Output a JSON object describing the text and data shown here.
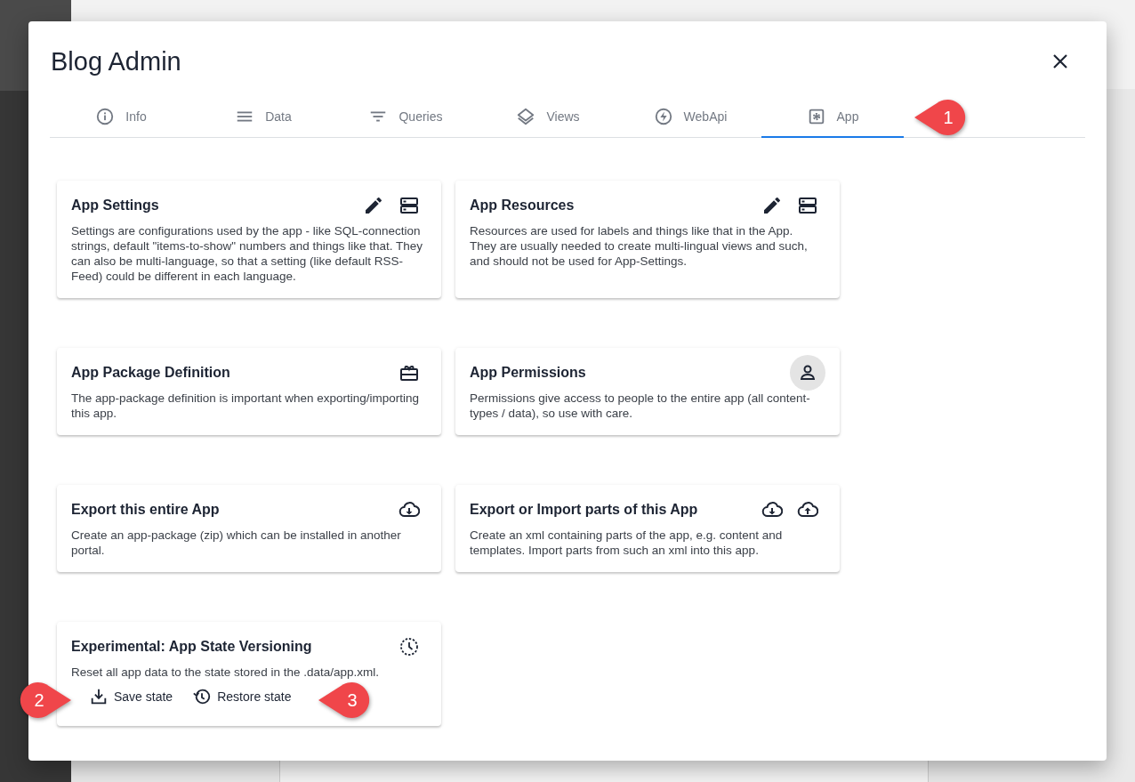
{
  "dialog": {
    "title": "Blog Admin"
  },
  "tabs": [
    {
      "label": "Info",
      "kind": "info",
      "selected": false
    },
    {
      "label": "Data",
      "kind": "data",
      "selected": false
    },
    {
      "label": "Queries",
      "kind": "queries",
      "selected": false
    },
    {
      "label": "Views",
      "kind": "views",
      "selected": false
    },
    {
      "label": "WebApi",
      "kind": "webapi",
      "selected": false
    },
    {
      "label": "App",
      "kind": "app",
      "selected": true
    }
  ],
  "cards": [
    {
      "title": "App Settings",
      "description": "Settings are configurations used by the app - like SQL-connection strings, default \"items-to-show\" numbers and things like that. They can also be multi-language, so that a setting (like default RSS-Feed) could be different in each language.",
      "icons": [
        {
          "kind": "edit",
          "hovered": false
        },
        {
          "kind": "storage",
          "hovered": false
        }
      ]
    },
    {
      "title": "App Resources",
      "description": "Resources are used for labels and things like that in the App. They are usually needed to create multi-lingual views and such, and should not be used for App-Settings.",
      "icons": [
        {
          "kind": "edit",
          "hovered": false
        },
        {
          "kind": "storage",
          "hovered": false
        }
      ]
    },
    {
      "title": "App Package Definition",
      "description": "The app-package definition is important when exporting/importing this app.",
      "icons": [
        {
          "kind": "package",
          "hovered": false
        }
      ]
    },
    {
      "title": "App Permissions",
      "description": "Permissions give access to people to the entire app (all content-types / data), so use with care.",
      "icons": [
        {
          "kind": "person",
          "hovered": true
        }
      ]
    },
    {
      "title": "Export this entire App",
      "description": "Create an app-package (zip) which can be installed in another portal.",
      "icons": [
        {
          "kind": "cloud-download",
          "hovered": false
        }
      ]
    },
    {
      "title": "Export or Import parts of this App",
      "description": "Create an xml containing parts of the app, e.g. content and templates. Import parts from such an xml into this app.",
      "icons": [
        {
          "kind": "cloud-download",
          "hovered": false
        },
        {
          "kind": "cloud-upload",
          "hovered": false
        }
      ]
    },
    {
      "title": "Experimental: App State Versioning",
      "description": "Reset all app data to the state stored in the .data/app.xml.",
      "icons": [
        {
          "kind": "history",
          "hovered": false
        }
      ],
      "actions": [
        {
          "label": "Save state",
          "kind": "download"
        },
        {
          "label": "Restore state",
          "kind": "restore"
        }
      ]
    }
  ],
  "callouts": [
    {
      "label": "1",
      "kind": "left"
    },
    {
      "label": "2",
      "kind": "right"
    },
    {
      "label": "3",
      "kind": "left"
    }
  ]
}
